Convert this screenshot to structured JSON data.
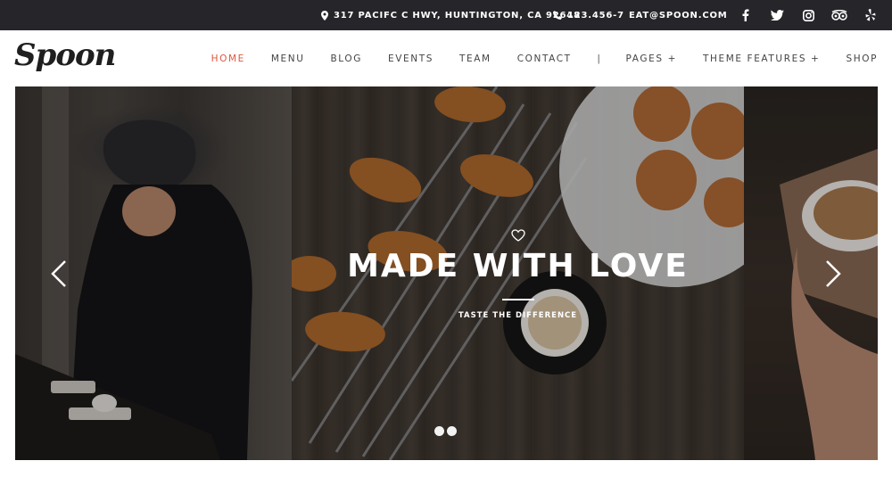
{
  "topbar": {
    "address": "317 PACIFC C HWY, HUNTINGTON, CA 92648",
    "phone": "123.456-7",
    "email": "EAT@SPOON.COM",
    "address_icon": "map-pin-icon",
    "phone_icon": "phone-icon",
    "socials": [
      "facebook-icon",
      "twitter-icon",
      "instagram-icon",
      "tripadvisor-icon",
      "yelp-icon"
    ]
  },
  "header": {
    "logo": "Spoon",
    "nav": {
      "home": "HOME",
      "menu": "MENU",
      "blog": "BLOG",
      "events": "EVENTS",
      "team": "TEAM",
      "contact": "CONTACT",
      "separator": "|",
      "pages": "PAGES +",
      "theme_features": "THEME FEATURES +",
      "shop": "SHOP"
    },
    "active_item": "HOME"
  },
  "slider": {
    "heading": "MADE WITH LOVE",
    "subheading": "TASTE THE DIFFERENCE",
    "heart_icon": "heart-icon",
    "prev_icon": "chevron-left-icon",
    "next_icon": "chevron-right-icon",
    "slide_count": 2
  },
  "colors": {
    "topbar_bg": "#25252a",
    "accent": "#e0553d",
    "nav_text": "#444444"
  }
}
